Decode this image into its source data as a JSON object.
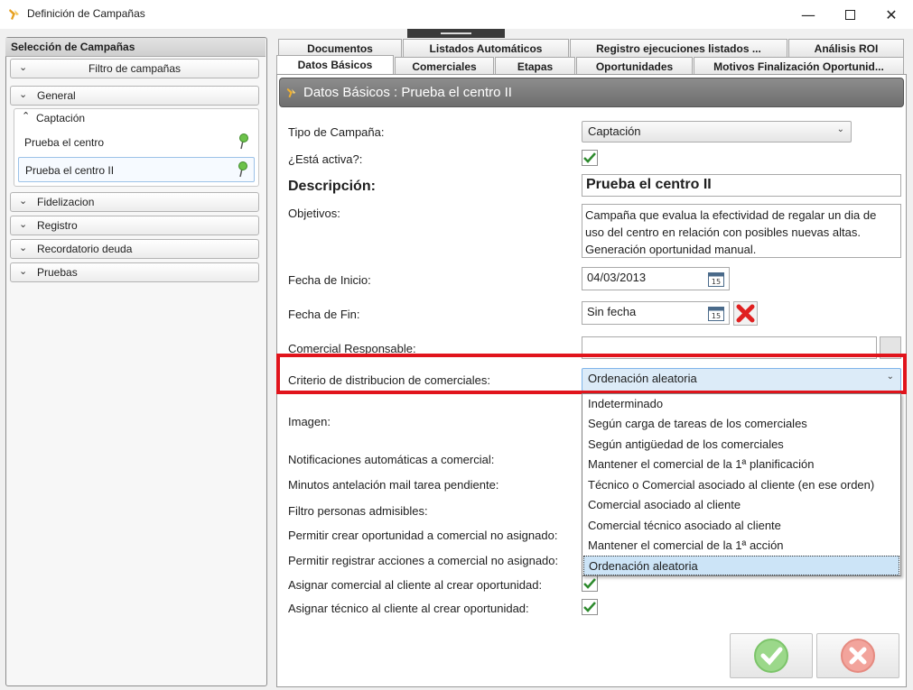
{
  "window": {
    "title": "Definición de Campañas"
  },
  "left": {
    "header": "Selección de Campañas",
    "filter_label": "Filtro de campañas",
    "groups": [
      "General",
      "Captación",
      "Fidelizacion",
      "Registro",
      "Recordatorio deuda",
      "Pruebas"
    ],
    "captacion_items": [
      "Prueba el centro",
      "Prueba el centro II"
    ]
  },
  "tabs": {
    "row1": [
      "Documentos",
      "Listados Automáticos",
      "Registro ejecuciones listados ...",
      "Análisis ROI"
    ],
    "row2": [
      "Datos Básicos",
      "Comerciales",
      "Etapas",
      "Oportunidades",
      "Motivos Finalización Oportunid..."
    ]
  },
  "section": {
    "title": "Datos Básicos : Prueba el centro II"
  },
  "form": {
    "tipo_label": "Tipo de Campaña:",
    "tipo_value": "Captación",
    "activa_label": "¿Está activa?:",
    "descripcion_label": "Descripción:",
    "descripcion_value": "Prueba el centro II",
    "objetivos_label": "Objetivos:",
    "objetivos_value": "Campaña que evalua la efectividad de regalar un dia de uso del centro en relación con posibles nuevas altas. Generación oportunidad manual.",
    "fecha_inicio_label": "Fecha de Inicio:",
    "fecha_inicio_value": "04/03/2013",
    "fecha_fin_label": "Fecha de Fin:",
    "fecha_fin_value": "Sin fecha",
    "comercial_label": "Comercial Responsable:",
    "criterio_label": "Criterio de distribucion de comerciales:",
    "criterio_value": "Ordenación aleatoria",
    "imagen_label": "Imagen:",
    "notif_label": "Notificaciones automáticas a comercial:",
    "minutos_label": "Minutos antelación mail tarea pendiente:",
    "filtro_label": "Filtro personas admisibles:",
    "permitir_op_label": "Permitir crear oportunidad a comercial no asignado:",
    "permitir_acc_label": "Permitir registrar acciones a comercial no asignado:",
    "asignar_com_label": "Asignar comercial al cliente al crear oportunidad:",
    "asignar_tec_label": "Asignar técnico al cliente al crear oportunidad:"
  },
  "dropdown_options": [
    "Indeterminado",
    "Según carga de tareas de los comerciales",
    "Según antigüedad de los comerciales",
    "Mantener el comercial de la 1ª planificación",
    "Técnico o Comercial asociado al cliente (en ese orden)",
    "Comercial asociado al cliente",
    "Comercial técnico asociado al cliente",
    "Mantener el comercial de la 1ª acción",
    "Ordenación aleatoria"
  ],
  "colors": {
    "highlight": "#e1141c",
    "check": "#2d8a2d",
    "selected_option": "#cce4f7"
  }
}
